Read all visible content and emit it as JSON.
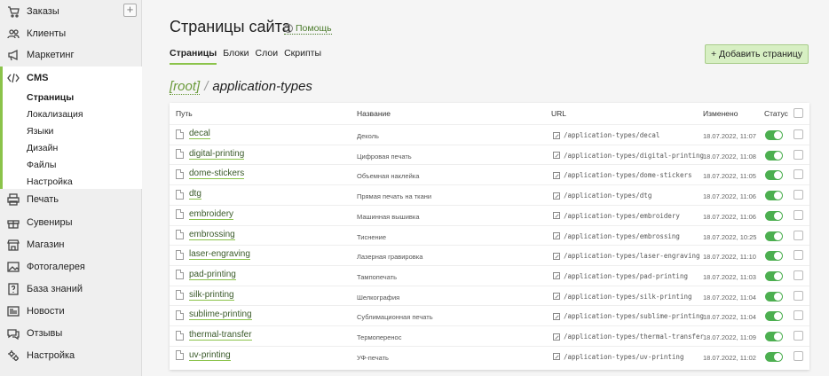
{
  "sidebar": {
    "items": [
      {
        "label": "Заказы",
        "icon": "cart-icon"
      },
      {
        "label": "Клиенты",
        "icon": "users-icon"
      },
      {
        "label": "Маркетинг",
        "icon": "megaphone-icon"
      },
      {
        "label": "CMS",
        "icon": "code-icon"
      },
      {
        "label": "Печать",
        "icon": "printer-icon"
      },
      {
        "label": "Сувениры",
        "icon": "gift-icon"
      },
      {
        "label": "Магазин",
        "icon": "store-icon"
      },
      {
        "label": "Фотогалерея",
        "icon": "image-icon"
      },
      {
        "label": "База знаний",
        "icon": "help-book-icon"
      },
      {
        "label": "Новости",
        "icon": "news-icon"
      },
      {
        "label": "Отзывы",
        "icon": "chat-icon"
      },
      {
        "label": "Настройка",
        "icon": "gear-icon"
      }
    ],
    "add_label": "+",
    "cms_sub": [
      "Страницы",
      "Локализация",
      "Языки",
      "Дизайн",
      "Файлы",
      "Настройка"
    ]
  },
  "header": {
    "title": "Страницы сайта",
    "help": "Помощь",
    "help_icon": "?",
    "add_button": "+ Добавить страницу"
  },
  "tabs": [
    "Страницы",
    "Блоки",
    "Слои",
    "Скрипты"
  ],
  "breadcrumb": {
    "root": "[root]",
    "sep": "/",
    "current": "application-types"
  },
  "table": {
    "headers": {
      "path": "Путь",
      "name": "Название",
      "url": "URL",
      "modified": "Изменено",
      "status": "Статус"
    },
    "rows": [
      {
        "path": "decal",
        "name": "Деколь",
        "url": "/application-types/decal",
        "date": "18.07.2022, 11:07",
        "status": true
      },
      {
        "path": "digital-printing",
        "name": "Цифровая печать",
        "url": "/application-types/digital-printing",
        "date": "18.07.2022, 11:08",
        "status": true
      },
      {
        "path": "dome-stickers",
        "name": "Объемная наклейка",
        "url": "/application-types/dome-stickers",
        "date": "18.07.2022, 11:05",
        "status": true
      },
      {
        "path": "dtg",
        "name": "Прямая печать на ткани",
        "url": "/application-types/dtg",
        "date": "18.07.2022, 11:06",
        "status": true
      },
      {
        "path": "embroidery",
        "name": "Машинная вышивка",
        "url": "/application-types/embroidery",
        "date": "18.07.2022, 11:06",
        "status": true
      },
      {
        "path": "embrossing",
        "name": "Тиснение",
        "url": "/application-types/embrossing",
        "date": "18.07.2022, 10:25",
        "status": true
      },
      {
        "path": "laser-engraving",
        "name": "Лазерная гравировка",
        "url": "/application-types/laser-engraving",
        "date": "18.07.2022, 11:10",
        "status": true
      },
      {
        "path": "pad-printing",
        "name": "Тампопечать",
        "url": "/application-types/pad-printing",
        "date": "18.07.2022, 11:03",
        "status": true
      },
      {
        "path": "silk-printing",
        "name": "Шелкография",
        "url": "/application-types/silk-printing",
        "date": "18.07.2022, 11:04",
        "status": true
      },
      {
        "path": "sublime-printing",
        "name": "Сублимационная печать",
        "url": "/application-types/sublime-printing",
        "date": "18.07.2022, 11:04",
        "status": true
      },
      {
        "path": "thermal-transfer",
        "name": "Термоперенос",
        "url": "/application-types/thermal-transfer",
        "date": "18.07.2022, 11:09",
        "status": true
      },
      {
        "path": "uv-printing",
        "name": "УФ-печать",
        "url": "/application-types/uv-printing",
        "date": "18.07.2022, 11:02",
        "status": true
      }
    ]
  },
  "colors": {
    "accent": "#8bc34a",
    "toggle_on": "#4caf50",
    "add_button_bg": "#d7efc3"
  }
}
